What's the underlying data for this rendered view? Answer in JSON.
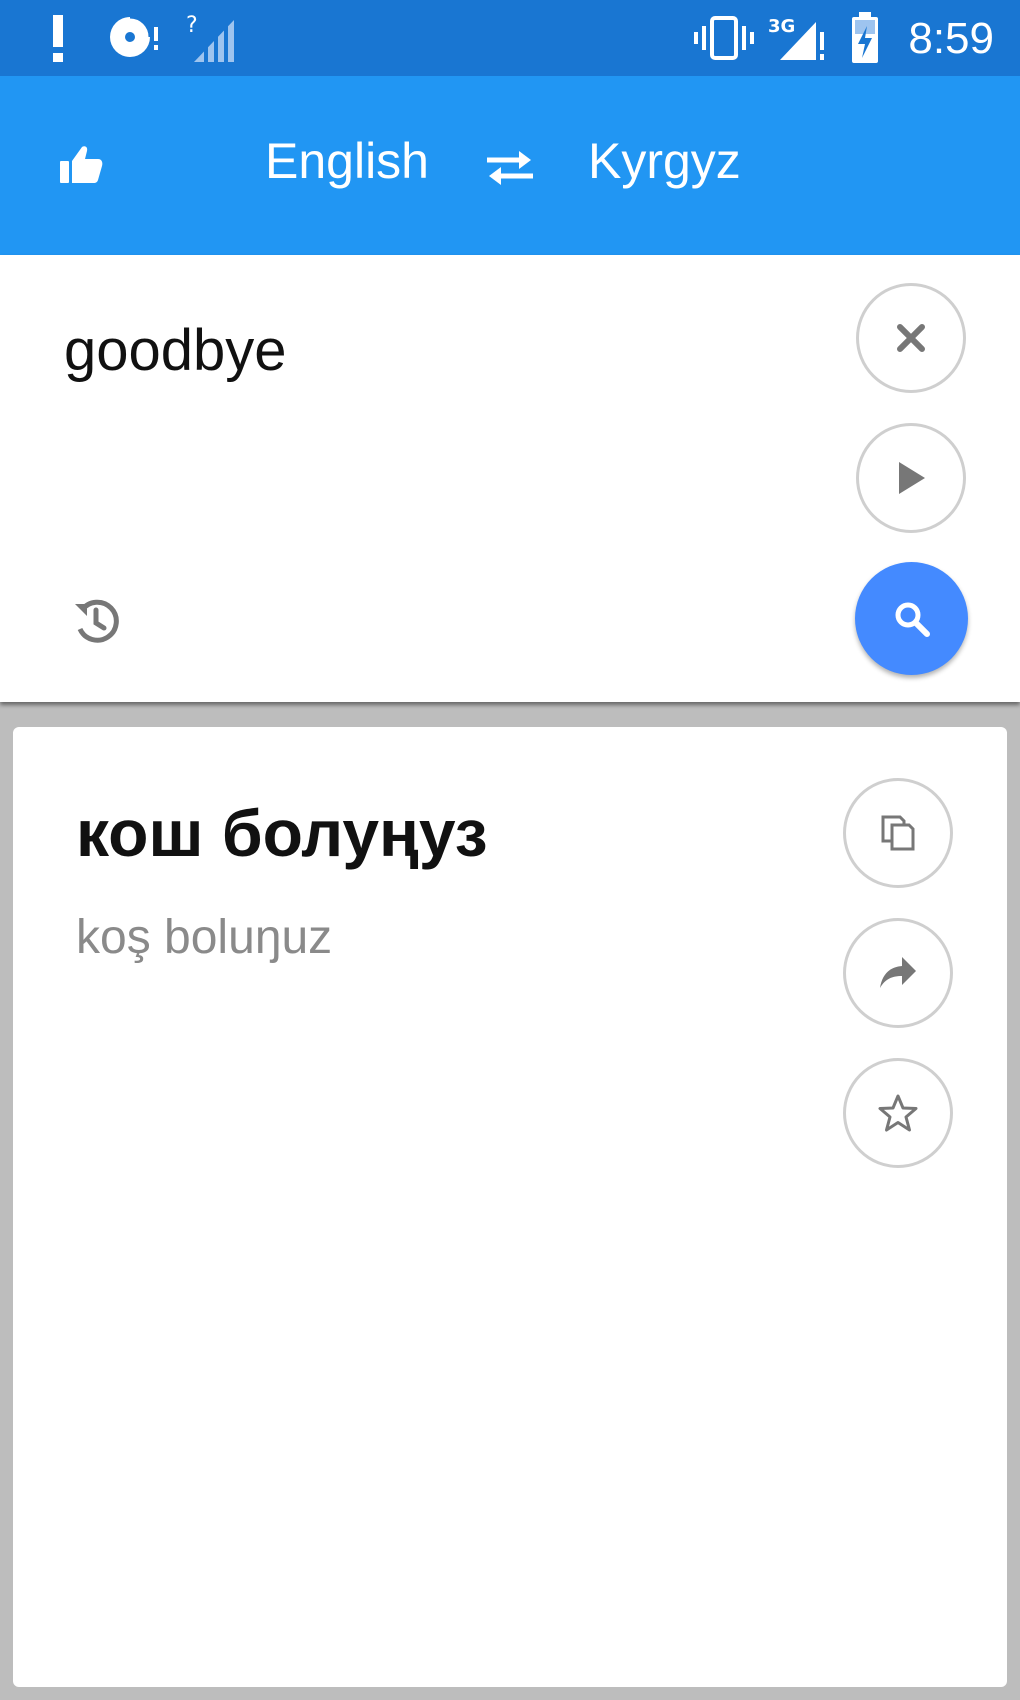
{
  "status_bar": {
    "time": "8:59",
    "network_label": "3G",
    "icons": [
      "alert-icon",
      "sync-disc-icon",
      "no-signal-icon",
      "vibrate-icon",
      "signal-3g-icon",
      "battery-charging-icon"
    ]
  },
  "app_bar": {
    "source_language": "English",
    "target_language": "Kyrgyz",
    "icons": [
      "thumbs-up-icon",
      "swap-icon"
    ]
  },
  "input": {
    "text": "goodbye",
    "actions": [
      "clear-icon",
      "play-icon",
      "history-icon",
      "search-icon"
    ]
  },
  "result": {
    "translation": "кош болуңуз",
    "transliteration": "koş boluŋuz",
    "actions": [
      "copy-icon",
      "share-icon",
      "star-icon"
    ]
  },
  "colors": {
    "status_bar": "#1976d2",
    "app_bar": "#2196f3",
    "search_button": "#448aff",
    "background": "#bdbdbd"
  }
}
